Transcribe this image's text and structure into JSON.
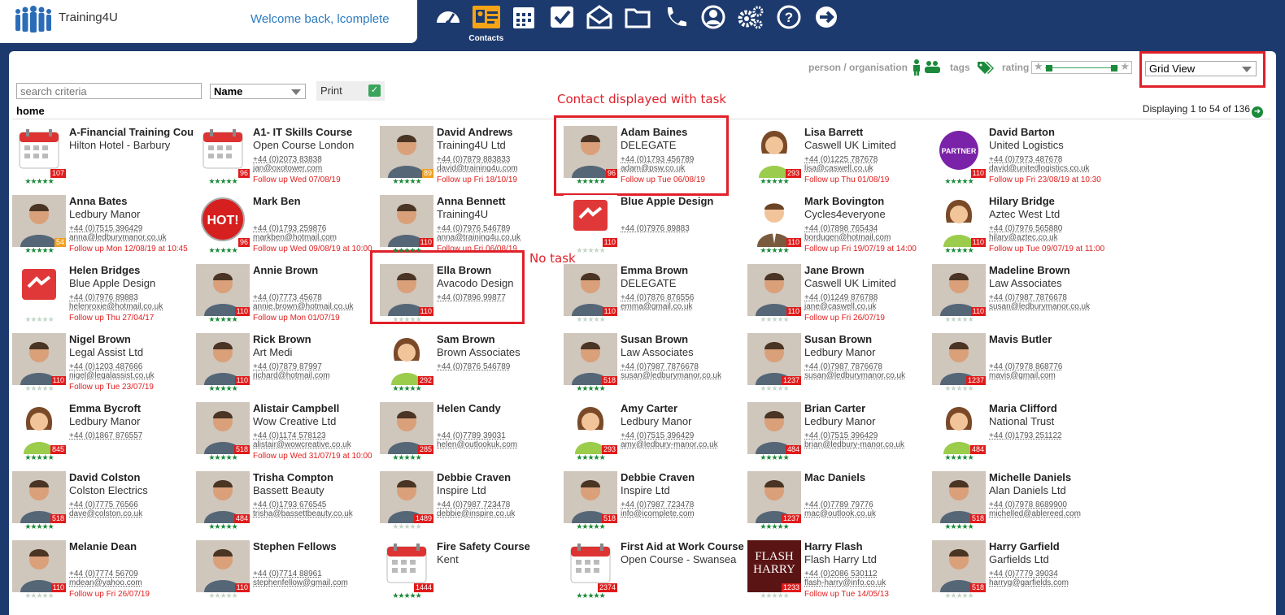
{
  "header": {
    "app_name": "Training4U",
    "welcome": "Welcome back, lcomplete",
    "nav": [
      {
        "icon": "dashboard-icon",
        "label": ""
      },
      {
        "icon": "contacts-icon",
        "label": "Contacts",
        "active": true
      },
      {
        "icon": "calendar-icon",
        "label": ""
      },
      {
        "icon": "tasks-check-icon",
        "label": ""
      },
      {
        "icon": "mail-icon",
        "label": ""
      },
      {
        "icon": "folder-icon",
        "label": ""
      },
      {
        "icon": "phone-icon",
        "label": ""
      },
      {
        "icon": "user-profile-icon",
        "label": ""
      },
      {
        "icon": "settings-gears-icon",
        "label": ""
      },
      {
        "icon": "help-icon",
        "label": ""
      },
      {
        "icon": "logout-arrow-icon",
        "label": ""
      }
    ]
  },
  "toolbar": {
    "search_placeholder": "search criteria",
    "sort_value": "Name",
    "print_label": "Print",
    "home_label": "home",
    "person_org_label": "person / organisation",
    "tags_label": "tags",
    "rating_label": "rating",
    "view_value": "Grid View",
    "displaying": "Displaying 1 to 54 of 136"
  },
  "annotations": {
    "with_task": "Contact displayed with task",
    "no_task": "No task"
  },
  "colors": {
    "brand_navy": "#1d3a6e",
    "accent_orange": "#f6a416",
    "score_red": "#e01b1b",
    "score_orange": "#f0a020",
    "star_green": "#1b8a3a",
    "follow_red": "#e02020"
  },
  "contacts": [
    {
      "name": "A-Financial Training Cou",
      "org": "Hilton Hotel - Barbury",
      "phone": "",
      "email": "",
      "follow": "",
      "score": "107",
      "thumb": "calendar",
      "stars": 5
    },
    {
      "name": "A1- IT Skills Course",
      "org": "Open Course London",
      "phone": "+44 (0)2073 83838",
      "email": "jan@oxotower.com",
      "follow": "Follow up Wed 07/08/19",
      "score": "96",
      "thumb": "calendar",
      "stars": 5
    },
    {
      "name": "David Andrews",
      "org": "Training4U Ltd",
      "phone": "+44 (0)7879 883833",
      "email": "david@training4u.com",
      "follow": "Follow up Fri 18/10/19",
      "score": "89",
      "score_color": "orange",
      "thumb": "photo",
      "stars": 5
    },
    {
      "name": "Adam Baines",
      "org": "DELEGATE",
      "phone": "+44 (0)1793 456789",
      "email": "adam@psw.co.uk",
      "follow": "Follow up Tue 06/08/19",
      "score": "96",
      "thumb": "photo",
      "stars": 5
    },
    {
      "name": "Lisa Barrett",
      "org": "Caswell UK Limited",
      "phone": "+44 (0)1225 787678",
      "email": "lisa@caswell.co.uk",
      "follow": "Follow up Thu 01/08/19",
      "score": "293",
      "thumb": "female",
      "stars": 5
    },
    {
      "name": "David Barton",
      "org": "United Logistics",
      "phone": "+44 (0)7973 487678",
      "email": "david@unitedlogistics.co.uk",
      "follow": "Follow up Fri 23/08/19 at 10:30",
      "score": "110",
      "thumb": "partner",
      "stars": 5
    },
    {
      "name": "Anna Bates",
      "org": "Ledbury Manor",
      "phone": "+44 (0)7515 396429",
      "email": "anna@ledburymanor.co.uk",
      "follow": "Follow up Mon 12/08/19 at 10:45",
      "score": "54",
      "score_color": "orange",
      "thumb": "photo",
      "stars": 5
    },
    {
      "name": "Mark Ben",
      "org": "",
      "phone": "+44 (0)1793 259876",
      "email": "markben@hotmail.com",
      "follow": "Follow up Wed 09/08/19 at 10:00",
      "score": "96",
      "thumb": "hot",
      "stars": 5
    },
    {
      "name": "Anna Bennett",
      "org": "Training4U",
      "phone": "+44 (0)7976 546789",
      "email": "anna@training4u.co.uk",
      "follow": "Follow up Fri 06/08/19",
      "score": "110",
      "thumb": "photo",
      "stars": 5
    },
    {
      "name": "Blue Apple Design",
      "org": "",
      "phone": "+44 (0)7976 89883",
      "email": "",
      "follow": "",
      "score": "110",
      "thumb": "suppliers",
      "stars": 0
    },
    {
      "name": "Mark Bovington",
      "org": "Cycles4everyone",
      "phone": "+44 (0)7898 765434",
      "email": "bordugen@hotmail.com",
      "follow": "Follow up Fri 19/07/19 at 14:00",
      "score": "110",
      "thumb": "male",
      "stars": 5
    },
    {
      "name": "Hilary Bridge",
      "org": "Aztec West Ltd",
      "phone": "+44 (0)7976 565880",
      "email": "hilary@aztec.co.uk",
      "follow": "Follow up Tue 09/07/19 at 11:00",
      "score": "110",
      "thumb": "female",
      "stars": 5
    },
    {
      "name": "Helen Bridges",
      "org": "Blue Apple Design",
      "phone": "+44 (0)7976 89883",
      "email": "helenroxie@hotmail.co.uk",
      "follow": "Follow up Thu 27/04/17",
      "score": "",
      "thumb": "suppliers",
      "stars": 0
    },
    {
      "name": "Annie Brown",
      "org": "",
      "phone": "+44 (0)7773 45678",
      "email": "annie.brown@hotmail.co.uk",
      "follow": "Follow up Mon 01/07/19",
      "score": "110",
      "thumb": "photo",
      "stars": 5
    },
    {
      "name": "Ella Brown",
      "org": "Avacodo Design",
      "phone": "+44 (0)7896 99877",
      "email": "",
      "follow": "",
      "score": "110",
      "thumb": "photo",
      "stars": 0
    },
    {
      "name": "Emma Brown",
      "org": "DELEGATE",
      "phone": "+44 (0)7876 876556",
      "email": "emma@gmail.co.uk",
      "follow": "",
      "score": "110",
      "thumb": "photo",
      "stars": 0
    },
    {
      "name": "Jane Brown",
      "org": "Caswell UK Limited",
      "phone": "+44 (0)1249 876788",
      "email": "jane@caswell.co.uk",
      "follow": "Follow up Fri 26/07/19",
      "score": "110",
      "thumb": "photo",
      "stars": 0
    },
    {
      "name": "Madeline Brown",
      "org": "Law Associates",
      "phone": "+44 (0)7987 7876678",
      "email": "susan@ledburymanor.co.uk",
      "follow": "",
      "score": "110",
      "thumb": "photo",
      "stars": 0
    },
    {
      "name": "Nigel Brown",
      "org": "Legal Assist Ltd",
      "phone": "+44 (0)1203 487666",
      "email": "nigel@legalassist.co.uk",
      "follow": "Follow up Tue 23/07/19",
      "score": "110",
      "thumb": "photo",
      "stars": 0
    },
    {
      "name": "Rick Brown",
      "org": "Art Medi",
      "phone": "+44 (0)7879 87997",
      "email": "richard@hotmail.com",
      "follow": "",
      "score": "110",
      "thumb": "photo",
      "stars": 5
    },
    {
      "name": "Sam Brown",
      "org": "Brown Associates",
      "phone": "+44 (0)7876 546789",
      "email": "",
      "follow": "",
      "score": "292",
      "thumb": "female",
      "stars": 5
    },
    {
      "name": "Susan Brown",
      "org": "Law Associates",
      "phone": "+44 (0)7987 7876678",
      "email": "susan@ledburymanor.co.uk",
      "follow": "",
      "score": "518",
      "thumb": "photo",
      "stars": 5
    },
    {
      "name": "Susan Brown",
      "org": "Ledbury Manor",
      "phone": "+44 (0)7987 7876678",
      "email": "susan@ledburymanor.co.uk",
      "follow": "",
      "score": "1237",
      "thumb": "photo",
      "stars": 0
    },
    {
      "name": "Mavis Butler",
      "org": "",
      "phone": "+44 (0)7978 868776",
      "email": "mavis@gmail.com",
      "follow": "",
      "score": "1237",
      "thumb": "photo",
      "stars": 0
    },
    {
      "name": "Emma Bycroft",
      "org": "Ledbury Manor",
      "phone": "+44 (0)1867 876557",
      "email": "",
      "follow": "",
      "score": "845",
      "thumb": "female",
      "stars": 5
    },
    {
      "name": "Alistair Campbell",
      "org": "Wow Creative Ltd",
      "phone": "+44 (0)1174 578123",
      "email": "alistair@wowcreative.co.uk",
      "follow": "Follow up Wed 31/07/19 at 10:00",
      "score": "518",
      "thumb": "photo",
      "stars": 5
    },
    {
      "name": "Helen Candy",
      "org": "",
      "phone": "+44 (0)7789 39031",
      "email": "helen@outlookuk.com",
      "follow": "",
      "score": "285",
      "thumb": "photo",
      "stars": 5
    },
    {
      "name": "Amy Carter",
      "org": "Ledbury Manor",
      "phone": "+44 (0)7515 396429",
      "email": "amy@ledbury-manor.co.uk",
      "follow": "",
      "score": "293",
      "thumb": "female",
      "stars": 5
    },
    {
      "name": "Brian Carter",
      "org": "Ledbury Manor",
      "phone": "+44 (0)7515 396429",
      "email": "brian@ledbury-manor.co.uk",
      "follow": "",
      "score": "484",
      "thumb": "photo",
      "stars": 5
    },
    {
      "name": "Maria Clifford",
      "org": "National Trust",
      "phone": "+44 (0)1793 251122",
      "email": "",
      "follow": "",
      "score": "484",
      "thumb": "female",
      "stars": 5
    },
    {
      "name": "David Colston",
      "org": "Colston Electrics",
      "phone": "+44 (0)7775 76566",
      "email": "dave@colston.co.uk",
      "follow": "",
      "score": "518",
      "thumb": "photo",
      "stars": 5
    },
    {
      "name": "Trisha Compton",
      "org": "Bassett Beauty",
      "phone": "+44 (0)1793 676545",
      "email": "trisha@bassettbeauty.co.uk",
      "follow": "",
      "score": "484",
      "thumb": "photo",
      "stars": 5
    },
    {
      "name": "Debbie Craven",
      "org": "Inspire Ltd",
      "phone": "+44 (0)7987 723478",
      "email": "debbie@inspire.co.uk",
      "follow": "",
      "score": "1489",
      "thumb": "photo",
      "stars": 0
    },
    {
      "name": "Debbie Craven",
      "org": "Inspire Ltd",
      "phone": "+44 (0)7987 723478",
      "email": "info@icomplete.com",
      "follow": "",
      "score": "518",
      "thumb": "photo",
      "stars": 5
    },
    {
      "name": "Mac Daniels",
      "org": "",
      "phone": "+44 (0)7789 79776",
      "email": "mac@outlook.co.uk",
      "follow": "",
      "score": "1237",
      "thumb": "photo",
      "stars": 5
    },
    {
      "name": "Michelle Daniels",
      "org": "Alan Daniels Ltd",
      "phone": "+44 (0)7978 8689900",
      "email": "michelled@ablereed.com",
      "follow": "",
      "score": "518",
      "thumb": "photo",
      "stars": 5
    },
    {
      "name": "Melanie Dean",
      "org": "",
      "phone": "+44 (0)7774 56709",
      "email": "mdean@yahoo.com",
      "follow": "Follow up Fri 26/07/19",
      "score": "110",
      "thumb": "photo",
      "stars": 0
    },
    {
      "name": "Stephen Fellows",
      "org": "",
      "phone": "+44 (0)7714 88961",
      "email": "stephenfellow@gmail.com",
      "follow": "",
      "score": "110",
      "thumb": "photo",
      "stars": 0
    },
    {
      "name": "Fire Safety Course",
      "org": "Kent",
      "phone": "",
      "email": "",
      "follow": "",
      "score": "1444",
      "thumb": "calendar",
      "stars": 5
    },
    {
      "name": "First Aid at Work Course",
      "org": "Open Course - Swansea",
      "phone": "",
      "email": "",
      "follow": "",
      "score": "2374",
      "thumb": "calendar",
      "stars": 5
    },
    {
      "name": "Harry Flash",
      "org": "Flash Harry Ltd",
      "phone": "+44 (0)2086 530112",
      "email": "flash-harry@info.co.uk",
      "follow": "Follow up Tue 14/05/13",
      "score": "1233",
      "thumb": "flash",
      "stars": 0
    },
    {
      "name": "Harry Garfield",
      "org": "Garfields Ltd",
      "phone": "+44 (0)7779 39034",
      "email": "harryg@garfields.com",
      "follow": "",
      "score": "518",
      "thumb": "photo",
      "stars": 0
    }
  ]
}
